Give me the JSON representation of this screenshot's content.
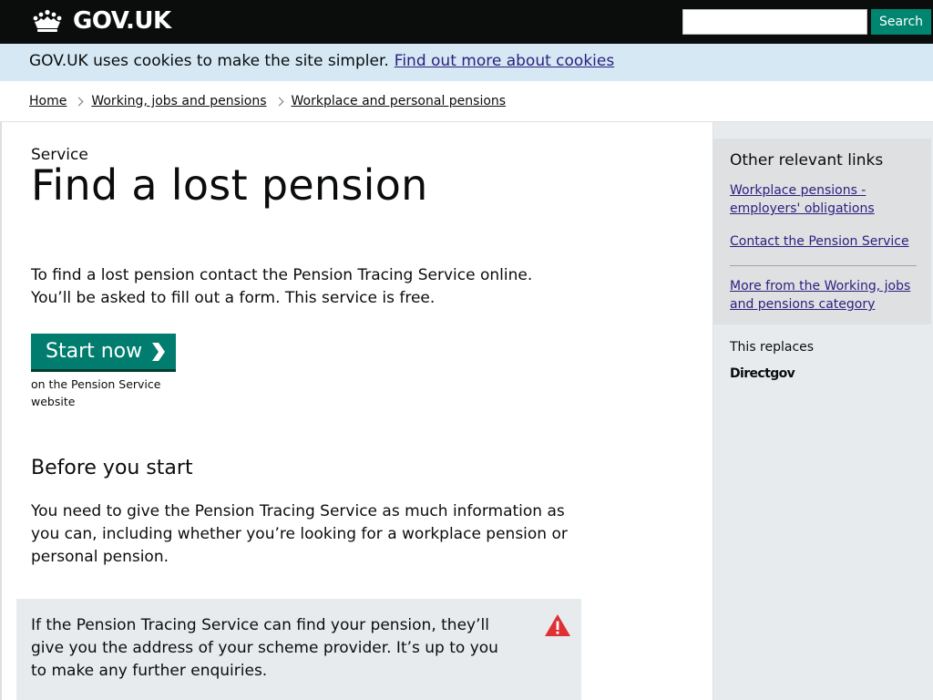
{
  "header": {
    "logo_text": "GOV.UK",
    "search_placeholder": "",
    "search_button_label": "Search"
  },
  "cookie_banner": {
    "text": "GOV.UK uses cookies to make the site simpler.",
    "link_label": "Find out more about cookies"
  },
  "breadcrumb": {
    "items": [
      {
        "label": "Home"
      },
      {
        "label": "Working, jobs and pensions"
      },
      {
        "label": "Workplace and personal pensions"
      }
    ]
  },
  "main": {
    "eyebrow": "Service",
    "title": "Find a lost pension",
    "intro_line1": "To find a lost pension contact the Pension Tracing Service online.",
    "intro_line2": "You’ll be asked to fill out a form. This service is free.",
    "start_button_label": "Start now",
    "start_note": "on the Pension Service website",
    "section_heading": "Before you start",
    "section_body": "You need to give the Pension Tracing Service as much information as you can, including whether you’re looking for a workplace pension or personal pension.",
    "callout_text": "If the Pension Tracing Service can find your pension, they’ll give you the address of your scheme provider. It’s up to you to make any further enquiries."
  },
  "sidebar": {
    "related_title": "Other relevant links",
    "links": [
      {
        "label": "Workplace pensions - employers' obligations"
      },
      {
        "label": "Contact the Pension Service"
      },
      {
        "label": "More from the Working, jobs and pensions category"
      }
    ],
    "replaces_label": "This replaces",
    "replaces_logo": "Directgov"
  },
  "colors": {
    "header_bg": "#0b0c0c",
    "search_button": "#008670",
    "cookie_banner_bg": "#d5e8f3",
    "link": "#2b1f7f",
    "start_button": "#007d6e",
    "sidebar_bg": "#e8ebee",
    "warning": "#df3034"
  },
  "icons": {
    "logo": "crown-icon",
    "start": "chevron-right-icon",
    "callout": "warning-icon"
  }
}
